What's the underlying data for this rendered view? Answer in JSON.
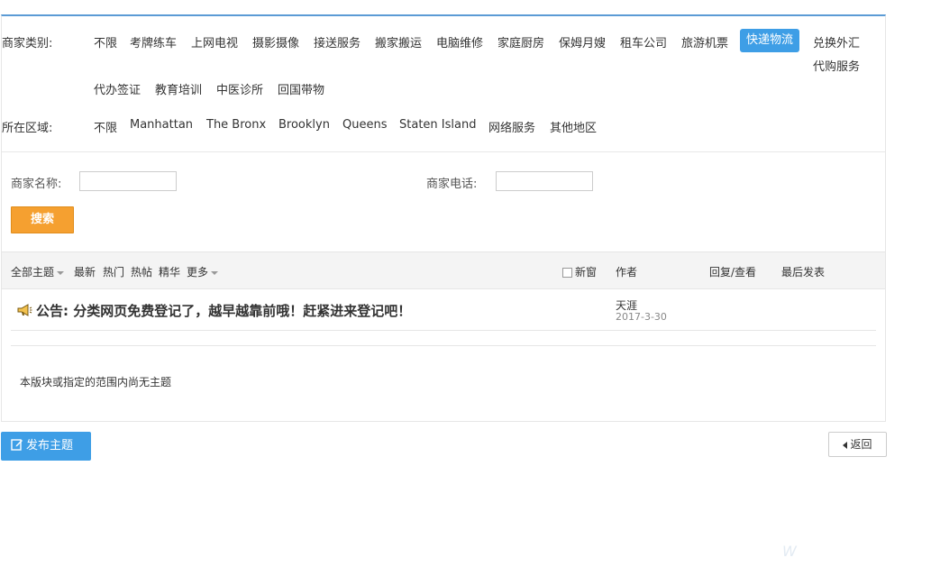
{
  "filters": {
    "category_label": "商家类别:",
    "category_tags": [
      "不限",
      "考牌练车",
      "上网电视",
      "摄影摄像",
      "接送服务",
      "搬家搬运",
      "电脑维修",
      "家庭厨房",
      "保姆月嫂",
      "租车公司",
      "旅游机票",
      "快递物流",
      "兑换外汇",
      "代购服务",
      "代办签证",
      "教育培训",
      "中医诊所",
      "回国带物"
    ],
    "category_active": "快递物流",
    "region_label": "所在区域:",
    "region_tags": [
      "不限",
      "Manhattan",
      "The Bronx",
      "Brooklyn",
      "Queens",
      "Staten Island",
      "网络服务",
      "其他地区"
    ]
  },
  "search": {
    "name_label": "商家名称:",
    "name_value": "",
    "phone_label": "商家电话:",
    "phone_value": "",
    "button_label": "搜索"
  },
  "thread_header": {
    "all_topics": "全部主题",
    "latest": "最新",
    "hot": "热门",
    "hot_posts": "热帖",
    "digest": "精华",
    "more": "更多",
    "new_window": "新窗",
    "author": "作者",
    "replies_views": "回复/查看",
    "last_post": "最后发表"
  },
  "notice": {
    "prefix": "公告:",
    "title": "分类网页免费登记了，越早越靠前哦！赶紧进来登记吧！",
    "author": "天涯",
    "date": "2017-3-30"
  },
  "empty_message": "本版块或指定的范围内尚无主题",
  "actions": {
    "post_label": "发布主题",
    "back_label": "返回"
  },
  "colors": {
    "accent": "#3e9ee6",
    "search_button": "#f5a030",
    "top_border": "#5b9bd5"
  }
}
